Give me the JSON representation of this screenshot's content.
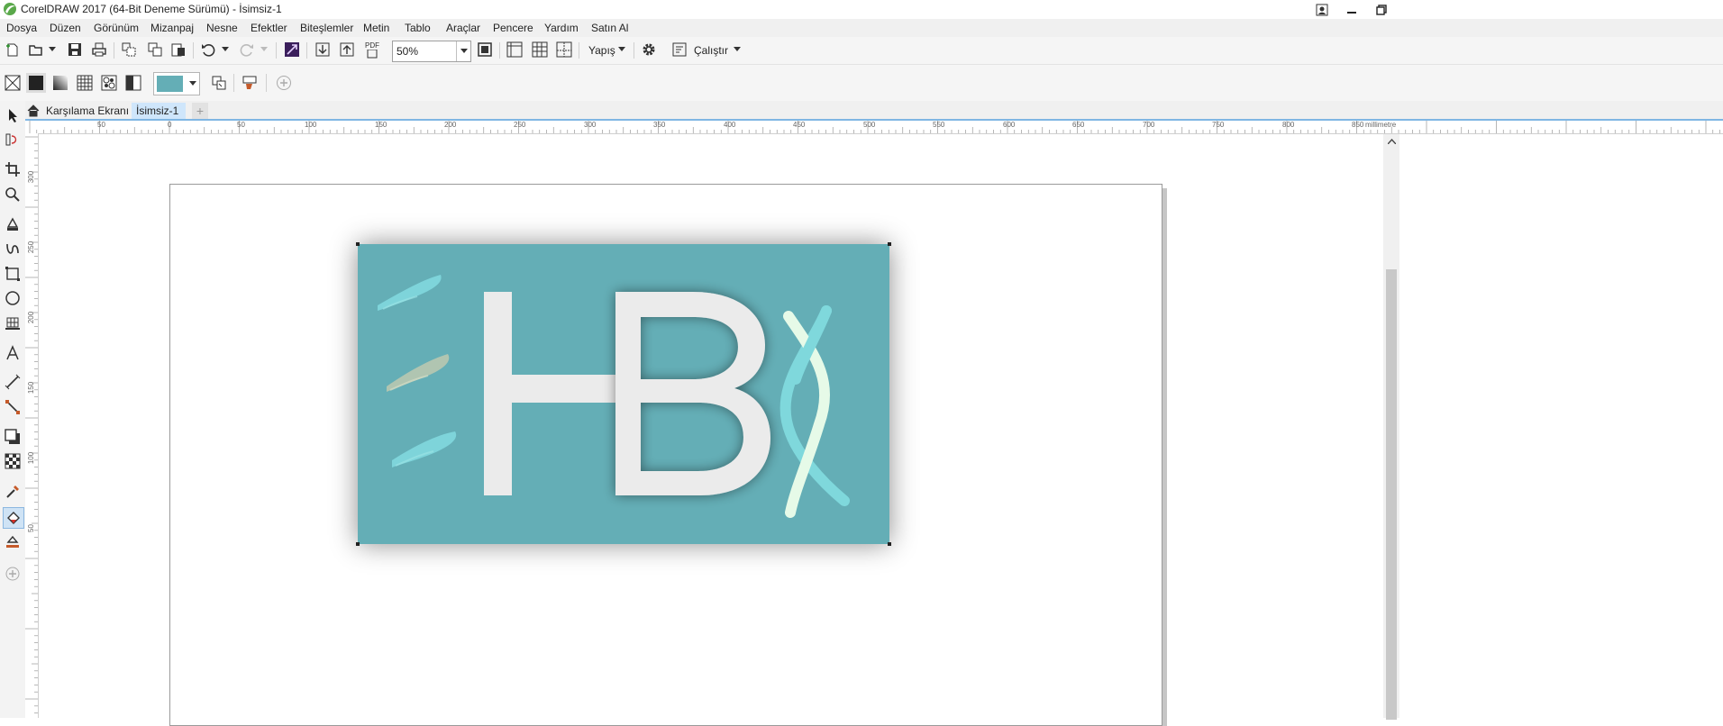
{
  "window": {
    "title": "CorelDRAW 2017 (64-Bit Deneme Sürümü) - İsimsiz-1"
  },
  "menu": [
    "Dosya",
    "Düzen",
    "Görünüm",
    "Mizanpaj",
    "Nesne",
    "Efektler",
    "Biteşlemler",
    "Metin",
    "Tablo",
    "Araçlar",
    "Pencere",
    "Yardım",
    "Satın Al"
  ],
  "toolbar": {
    "zoom_value": "50%",
    "snap_label": "Yapış",
    "launch_label": "Çalıştır",
    "pdf_label": "PDF"
  },
  "propbar": {
    "fill_color": "#64aeb6"
  },
  "tabs": {
    "welcome": "Karşılama Ekranı",
    "document": "İsimsiz-1",
    "add": "+"
  },
  "ruler": {
    "unit": "millimetre",
    "h_labels": [
      "50",
      "0",
      "50",
      "100",
      "150",
      "200",
      "250",
      "300",
      "350",
      "400",
      "450",
      "500",
      "550",
      "600",
      "650",
      "700",
      "750",
      "800",
      "850"
    ],
    "v_labels": [
      "300",
      "250",
      "200",
      "150",
      "100",
      "50"
    ]
  },
  "artwork": {
    "letters": "HB",
    "background": "#64aeb6",
    "letter_color": "#ebebeb",
    "ribbon_colors": [
      "#7fd8dc",
      "#e6fae8"
    ]
  }
}
